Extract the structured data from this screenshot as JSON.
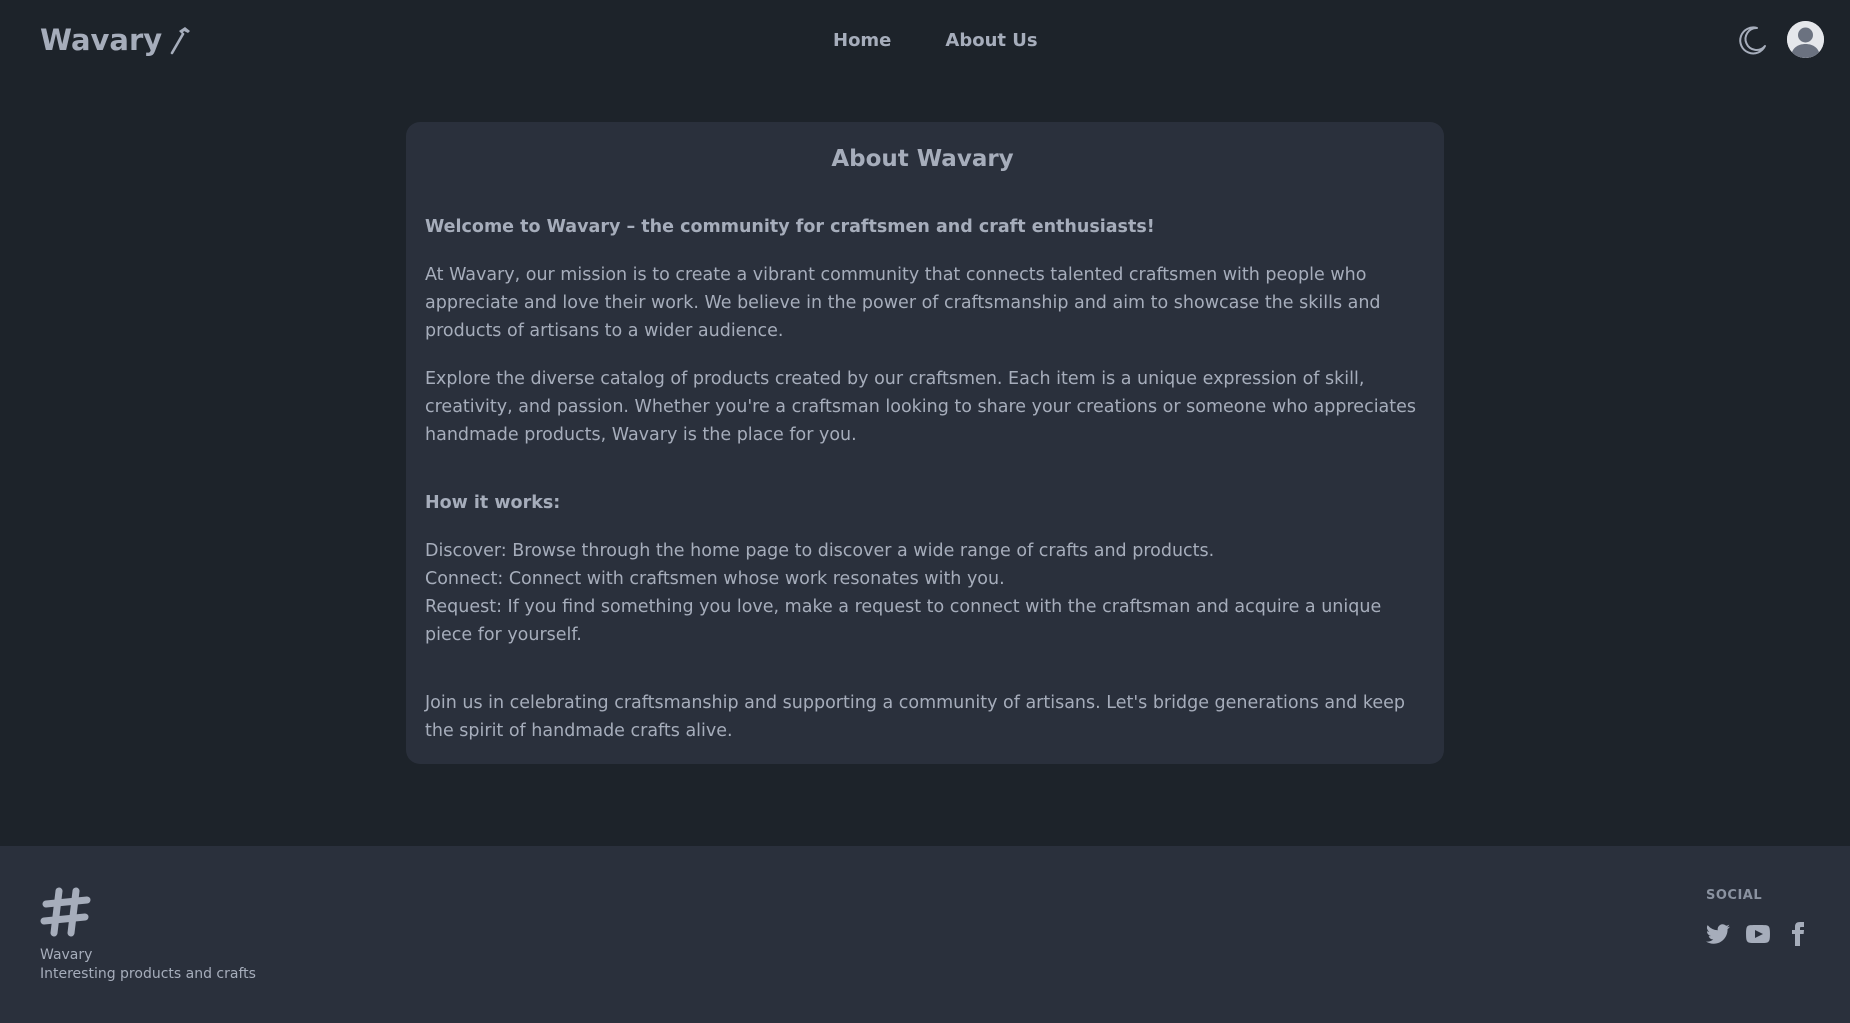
{
  "navbar": {
    "brand": "Wavary",
    "links": [
      {
        "label": "Home"
      },
      {
        "label": "About Us"
      }
    ],
    "theme_icon": "moon-icon",
    "avatar_icon": "user-avatar-icon",
    "brand_icon": "hammer-icon"
  },
  "card": {
    "title": "About Wavary",
    "intro": "Welcome to Wavary – the community for craftsmen and craft enthusiasts!",
    "para1": "At Wavary, our mission is to create a vibrant community that connects talented craftsmen with people who appreciate and love their work. We believe in the power of craftsmanship and aim to showcase the skills and products of artisans to a wider audience.",
    "para2": "Explore the diverse catalog of products created by our craftsmen. Each item is a unique expression of skill, creativity, and passion. Whether you're a craftsman looking to share your creations or someone who appreciates handmade products, Wavary is the place for you.",
    "how_title": "How it works:",
    "steps": [
      "Discover: Browse through the home page to discover a wide range of crafts and products.",
      "Connect: Connect with craftsmen whose work resonates with you.",
      "Request: If you find something you love, make a request to connect with the craftsman and acquire a unique piece for yourself."
    ],
    "closing": "Join us in celebrating craftsmanship and supporting a community of artisans. Let's bridge generations and keep the spirit of handmade crafts alive."
  },
  "footer": {
    "logo_icon": "hashtag-icon",
    "name": "Wavary",
    "tagline": "Interesting products and crafts",
    "social_title": "Social",
    "social_icons": [
      "twitter-icon",
      "youtube-icon",
      "facebook-icon"
    ]
  },
  "colors": {
    "background": "#1d232a",
    "card": "#2a303c",
    "text": "#a6adbb"
  }
}
